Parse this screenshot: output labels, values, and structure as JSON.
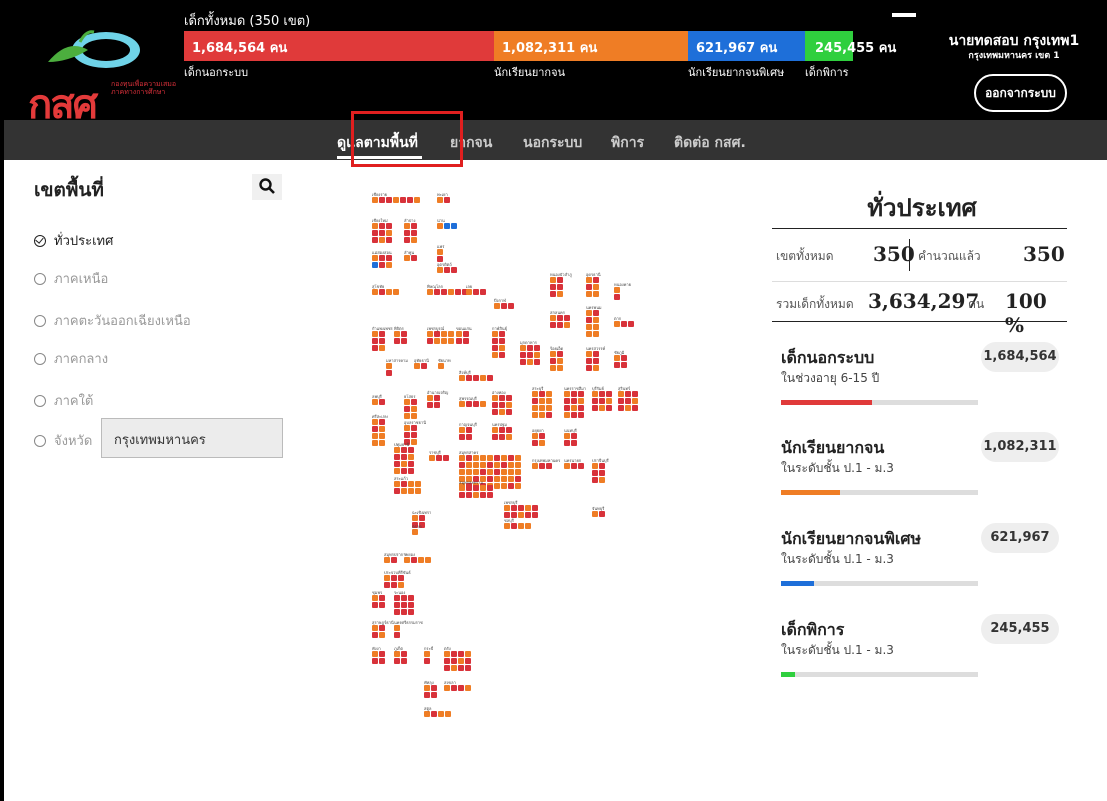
{
  "header": {
    "logo_text": "กสศ",
    "logo_subtitle": "กองทุนเพื่อความเสมอภาคทางการศึกษา",
    "total_label": "เด็กทั้งหมด (350 เขต)",
    "segments": [
      {
        "value": "1,684,564 คน",
        "label": "เด็กนอกระบบ",
        "color": "#e03a3a"
      },
      {
        "value": "1,082,311 คน",
        "label": "นักเรียนยากจน",
        "color": "#ef7d25"
      },
      {
        "value": "621,967 คน",
        "label": "นักเรียนยากจนพิเศษ",
        "color": "#1e6fd9"
      },
      {
        "value": "245,455 คน",
        "label": "เด็กพิการ",
        "color": "#2fcf3e"
      }
    ]
  },
  "user": {
    "name": "นายทดสอบ กรุงเทพ1",
    "org": "กรุงเทพมหานคร เขต 1",
    "logout_label": "ออกจากระบบ"
  },
  "nav": {
    "items": [
      "ดูแลตามพื้นที่",
      "ยากจน",
      "นอกระบบ",
      "พิการ",
      "ติดต่อ กสศ."
    ]
  },
  "sidebar": {
    "title": "เขตพื้นที่",
    "regions": [
      {
        "label": "ทั่วประเทศ",
        "checked": true
      },
      {
        "label": "ภาคเหนือ",
        "checked": false
      },
      {
        "label": "ภาคตะวันออกเฉียงเหนือ",
        "checked": false
      },
      {
        "label": "ภาคกลาง",
        "checked": false
      },
      {
        "label": "ภาคใต้",
        "checked": false
      },
      {
        "label": "จังหวัด",
        "checked": false
      }
    ],
    "province_value": "กรุงเทพมหานคร"
  },
  "map": {
    "provinces": [
      "เชียงราย",
      "พะเยา",
      "เชียงใหม่",
      "ลำปาง",
      "น่าน",
      "แพร่",
      "แม่ฮ่องสอน",
      "ลำพูน",
      "อุตรดิตถ์",
      "สุโขทัย",
      "พิษณุโลก",
      "เลย",
      "หนองบัวลำภู",
      "อุดรธานี",
      "หนองคาย",
      "บึงกาฬ",
      "สกลนคร",
      "นครพนม",
      "ตาก",
      "กำแพงเพชร",
      "พิจิตร",
      "เพชรบูรณ์",
      "ขอนแก่น",
      "กาฬสินธุ์",
      "มุกดาหาร",
      "ร้อยเอ็ด",
      "นครสวรรค์",
      "ชัยภูมิ",
      "มหาสารคาม",
      "อุทัยธานี",
      "ชัยนาท",
      "สิงห์บุรี",
      "ลพบุรี",
      "ยโสธร",
      "อำนาจเจริญ",
      "สุพรรณบุรี",
      "อ่างทอง",
      "สระบุรี",
      "นครราชสีมา",
      "บุรีรัมย์",
      "สุรินทร์",
      "ศรีสะเกษ",
      "อุบลราชธานี",
      "กาญจนบุรี",
      "นครปฐม",
      "อยุธยา",
      "นนทบุรี",
      "ปทุมธานี",
      "ราชบุรี",
      "สมุทรสาคร",
      "กรุงเทพมหานคร",
      "นครนายก",
      "ปราจีนบุรี",
      "สระแก้ว",
      "สมุทรสงคราม",
      "เพชรบุรี",
      "ฉะเชิงเทรา",
      "ชลบุรี",
      "จันทบุรี",
      "ตราด",
      "สมุทรปราการ",
      "ระยอง",
      "ประจวบคีรีขันธ์",
      "ชุมพร",
      "ระนอง",
      "สุราษฎร์ธานี",
      "นครศรีธรรมราช",
      "พังงา",
      "ภูเก็ต",
      "กระบี่",
      "ตรัง",
      "พัทลุง",
      "สงขลา",
      "สตูล",
      "ปัตตานี",
      "ยะลา",
      "นราธิวาส"
    ]
  },
  "stats": {
    "title": "ทั่วประเทศ",
    "district_label": "เขตทั้งหมด",
    "district_value": "350",
    "computed_label": "คำนวณแล้ว",
    "computed_value": "350",
    "total_label": "รวมเด็กทั้งหมด",
    "total_value": "3,634,297",
    "total_unit": "คน",
    "percent": "100 %",
    "categories": [
      {
        "title": "เด็กนอกระบบ",
        "sub": "ในช่วงอายุ 6-15 ปี",
        "value": "1,684,564",
        "color": "#e03a3a",
        "fraction": 0.46
      },
      {
        "title": "นักเรียนยากจน",
        "sub": "ในระดับชั้น ป.1 - ม.3",
        "value": "1,082,311",
        "color": "#ef7d25",
        "fraction": 0.3
      },
      {
        "title": "นักเรียนยากจนพิเศษ",
        "sub": "ในระดับชั้น ป.1 - ม.3",
        "value": "621,967",
        "color": "#1e6fd9",
        "fraction": 0.17
      },
      {
        "title": "เด็กพิการ",
        "sub": "ในระดับชั้น ป.1 - ม.3",
        "value": "245,455",
        "color": "#2fcf3e",
        "fraction": 0.07
      }
    ]
  }
}
